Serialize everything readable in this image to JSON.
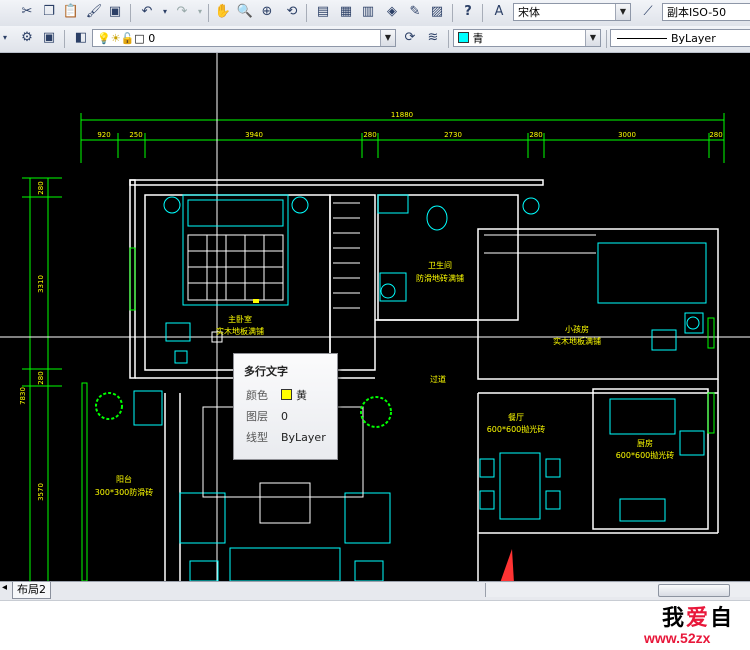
{
  "toolbar_top": {
    "font_combo": "宋体",
    "dimstyle_combo": "副本ISO-50"
  },
  "toolbar_layers": {
    "layer_combo": "0",
    "color_combo": "青",
    "linetype_combo": "ByLayer"
  },
  "drawing": {
    "dims_top": [
      "11880"
    ],
    "dims_sub": [
      "920",
      "250",
      "3940",
      "280",
      "2730",
      "280",
      "3000",
      "280"
    ],
    "dims_left": [
      "280",
      "3310",
      "280",
      "7830",
      "3570"
    ],
    "rooms": [
      {
        "name": "主卧室",
        "floor": "实木地板满铺"
      },
      {
        "name": "卫生间",
        "floor": "防滑地砖满铺"
      },
      {
        "name": "小孩房",
        "floor": "实木地板满铺"
      },
      {
        "name": "过道",
        "floor": ""
      },
      {
        "name": "餐厅",
        "floor": "600*600抛光砖"
      },
      {
        "name": "厨房",
        "floor": "600*600抛光砖"
      },
      {
        "name": "阳台",
        "floor": "300*300防滑砖"
      }
    ]
  },
  "tooltip": {
    "title": "多行文字",
    "rows": [
      {
        "label": "颜色",
        "value": "黄"
      },
      {
        "label": "图层",
        "value": "0"
      },
      {
        "label": "线型",
        "value": "ByLayer"
      }
    ]
  },
  "layout_tabs": {
    "tab": "布局2"
  },
  "watermark": {
    "line1a": "我",
    "heart": "爱",
    "line1b": "自",
    "url": "www.52zx"
  },
  "colors": {
    "canvas": "#000000",
    "walls": "#ffffff",
    "furniture": "#00ffff",
    "dims": "#00ff00",
    "labels": "#ffff00"
  }
}
